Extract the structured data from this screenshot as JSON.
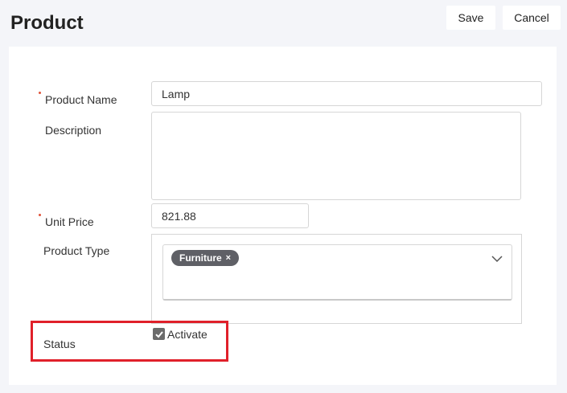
{
  "page": {
    "title": "Product"
  },
  "toolbar": {
    "save_label": "Save",
    "cancel_label": "Cancel"
  },
  "form": {
    "product_name": {
      "label": "Product Name",
      "value": "Lamp",
      "required": true
    },
    "description": {
      "label": "Description",
      "value": ""
    },
    "unit_price": {
      "label": "Unit Price",
      "value": "821.88",
      "required": true
    },
    "product_type": {
      "label": "Product Type",
      "selected": [
        "Furniture"
      ],
      "remove_glyph": "×"
    },
    "status": {
      "label": "Status",
      "checkbox_label": "Activate",
      "checked": true
    }
  },
  "colors": {
    "required_marker": "#e0533a",
    "highlight": "#e0202a",
    "chip": "#5f6066"
  },
  "icons": {
    "dropdown": "chevron-down-icon",
    "check": "check-icon",
    "remove": "close-icon"
  }
}
